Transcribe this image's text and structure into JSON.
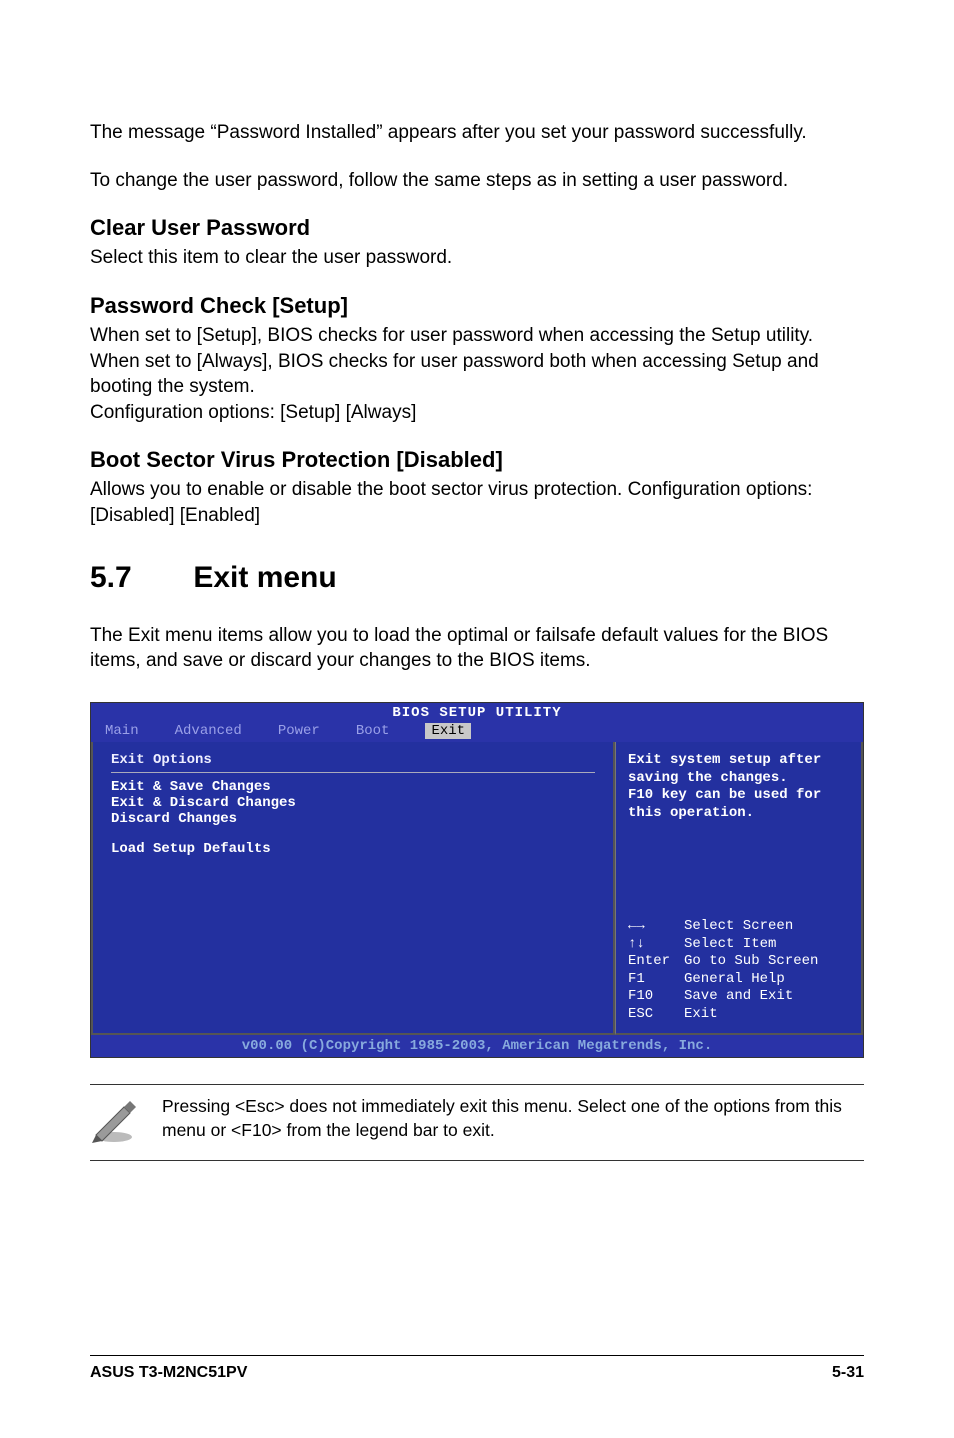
{
  "paragraphs": {
    "p1": "The message “Password Installed” appears after you set your password successfully.",
    "p2": "To change the user password, follow the same steps as in setting a user password."
  },
  "sections": {
    "clear_user_password": {
      "title": "Clear User Password",
      "desc": "Select this item to clear the user password."
    },
    "password_check": {
      "title": "Password Check [Setup]",
      "desc": "When set to [Setup], BIOS checks for user password when accessing the Setup utility. When set to [Always], BIOS checks for user password both when accessing Setup and booting the system.\nConfiguration options: [Setup] [Always]"
    },
    "boot_sector": {
      "title": "Boot Sector Virus Protection [Disabled]",
      "desc": "Allows you to enable or disable the boot sector virus protection. Configuration options: [Disabled] [Enabled]"
    }
  },
  "chapter": {
    "number": "5.7",
    "title": "Exit menu",
    "intro": "The Exit menu items allow you to load the optimal or failsafe default values for the BIOS items, and save or discard your changes to the BIOS items."
  },
  "bios": {
    "title": "BIOS SETUP UTILITY",
    "tabs": {
      "main": "Main",
      "advanced": "Advanced",
      "power": "Power",
      "boot": "Boot",
      "exit": "Exit"
    },
    "left": {
      "header": "Exit Options",
      "items": {
        "save": "Exit & Save Changes",
        "discard_exit": "Exit & Discard Changes",
        "discard": "Discard Changes",
        "load": "Load Setup Defaults"
      }
    },
    "right": {
      "help": "Exit system setup after saving the changes.\nF10 key can be used for this operation.",
      "keys": {
        "lr": {
          "k": "←→",
          "d": "Select Screen"
        },
        "ud": {
          "k": "↑↓",
          "d": "Select Item"
        },
        "enter": {
          "k": "Enter",
          "d": "Go to Sub Screen"
        },
        "f1": {
          "k": "F1",
          "d": "General Help"
        },
        "f10": {
          "k": "F10",
          "d": "Save and Exit"
        },
        "esc": {
          "k": "ESC",
          "d": "Exit"
        }
      }
    },
    "footer": "v00.00 (C)Copyright 1985-2003, American Megatrends, Inc."
  },
  "note": "Pressing <Esc> does not immediately exit this menu. Select one of the options from this menu or <F10> from the legend bar to exit.",
  "page_footer": {
    "left": "ASUS T3-M2NC51PV",
    "right": "5-31"
  }
}
